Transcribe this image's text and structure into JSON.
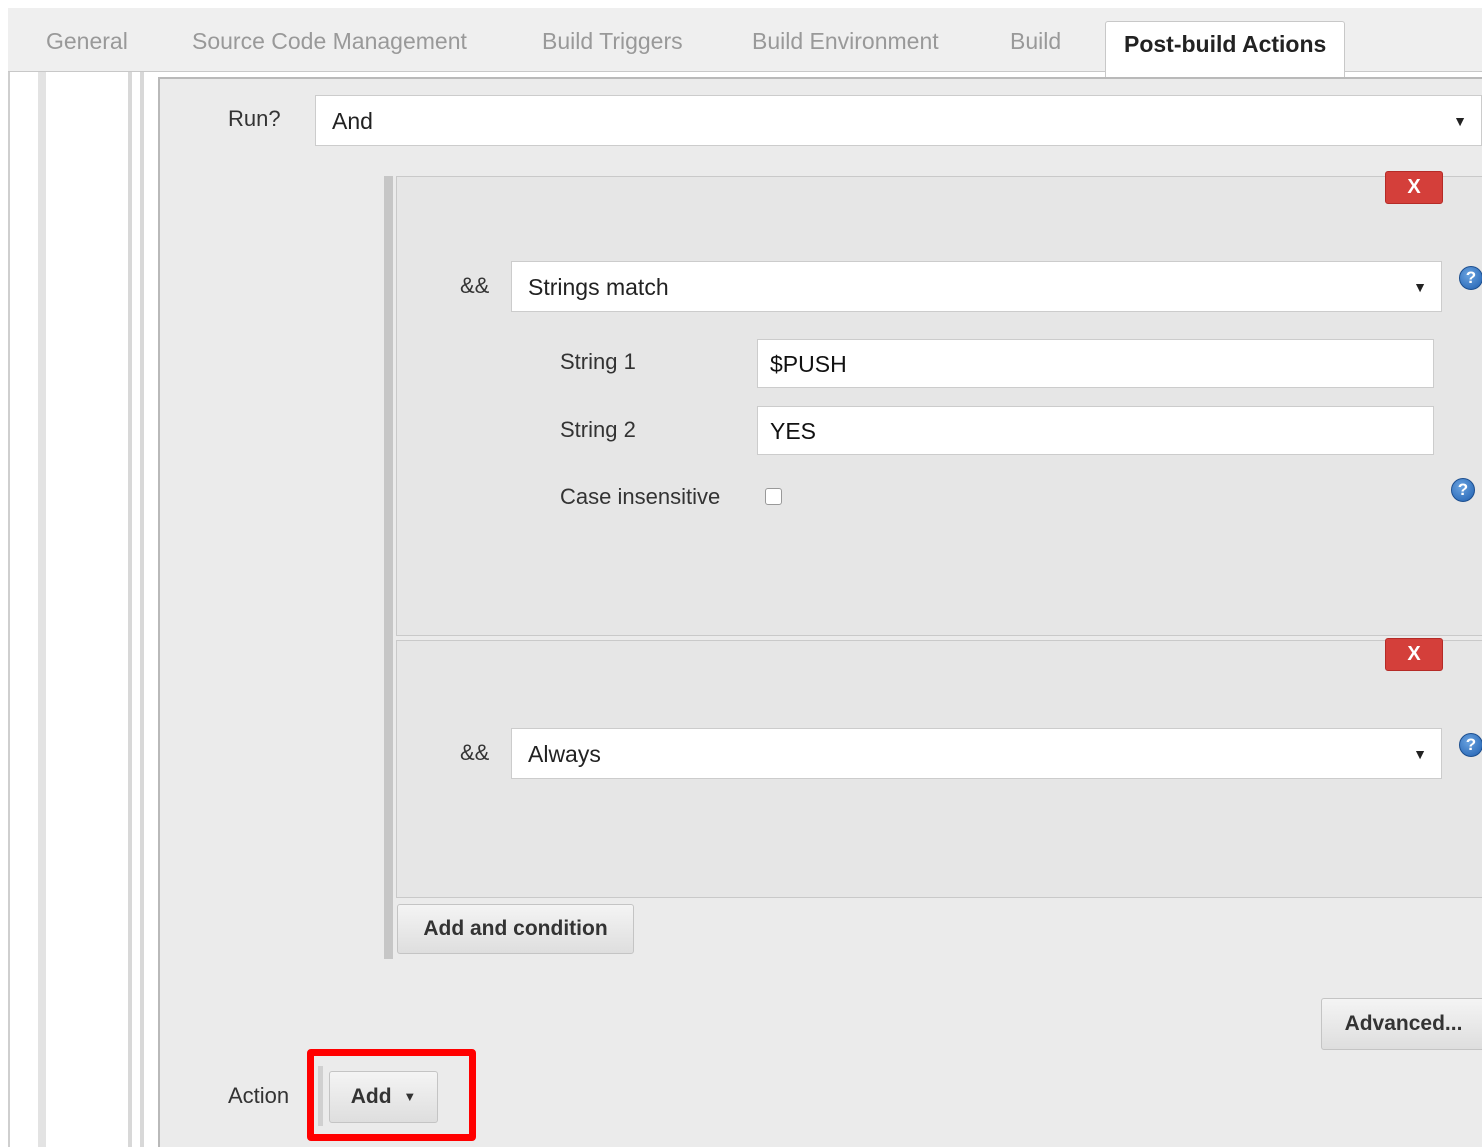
{
  "tabs": [
    {
      "label": "General",
      "active": false
    },
    {
      "label": "Source Code Management",
      "active": false
    },
    {
      "label": "Build Triggers",
      "active": false
    },
    {
      "label": "Build Environment",
      "active": false
    },
    {
      "label": "Build",
      "active": false
    },
    {
      "label": "Post-build Actions",
      "active": true
    }
  ],
  "run": {
    "label": "Run?",
    "value": "And"
  },
  "conditions": [
    {
      "operator": "&&",
      "type": "Strings match",
      "delete_label": "X",
      "fields": {
        "string1_label": "String 1",
        "string1_value": "$PUSH",
        "string2_label": "String 2",
        "string2_value": "YES",
        "case_label": "Case insensitive",
        "case_checked": false
      }
    },
    {
      "operator": "&&",
      "type": "Always",
      "delete_label": "X"
    }
  ],
  "add_condition_label": "Add and condition",
  "advanced_label": "Advanced...",
  "action": {
    "label": "Action",
    "add_label": "Add"
  },
  "help_glyph": "?",
  "icons": {
    "help": "help-icon",
    "caret": "caret-down-icon"
  },
  "colors": {
    "delete": "#d43f3a",
    "highlight": "#ff0000",
    "help": "#1f5fb0"
  }
}
